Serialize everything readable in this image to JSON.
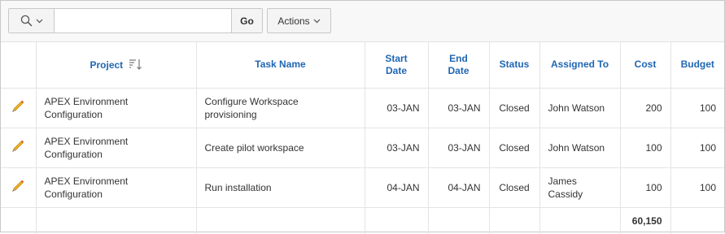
{
  "toolbar": {
    "search_placeholder": "",
    "search_value": "",
    "go_label": "Go",
    "actions_label": "Actions"
  },
  "columns": {
    "project": "Project",
    "task_name": "Task Name",
    "start_date_1": "Start",
    "start_date_2": "Date",
    "end_date_1": "End",
    "end_date_2": "Date",
    "status": "Status",
    "assigned_to": "Assigned To",
    "cost": "Cost",
    "budget": "Budget"
  },
  "rows": [
    {
      "project_1": "APEX Environment",
      "project_2": "Configuration",
      "task_1": "Configure Workspace",
      "task_2": "provisioning",
      "start_date": "03-JAN",
      "end_date": "03-JAN",
      "status": "Closed",
      "assigned_1": "John Watson",
      "assigned_2": "",
      "cost": "200",
      "budget": "100"
    },
    {
      "project_1": "APEX Environment",
      "project_2": "Configuration",
      "task_1": "Create pilot workspace",
      "task_2": "",
      "start_date": "03-JAN",
      "end_date": "03-JAN",
      "status": "Closed",
      "assigned_1": "John Watson",
      "assigned_2": "",
      "cost": "100",
      "budget": "100"
    },
    {
      "project_1": "APEX Environment",
      "project_2": "Configuration",
      "task_1": "Run installation",
      "task_2": "",
      "start_date": "04-JAN",
      "end_date": "04-JAN",
      "status": "Closed",
      "assigned_1": "James",
      "assigned_2": "Cassidy",
      "cost": "100",
      "budget": "100"
    }
  ],
  "totals": {
    "cost": "60,150"
  },
  "icons": {
    "search": "search-icon",
    "chevron": "chevron-down-icon",
    "sort": "sort-descending-icon",
    "edit": "pencil-icon"
  },
  "colors": {
    "header_link": "#1f66b3",
    "pencil_body": "#f2b21b",
    "pencil_tip": "#d9541e"
  }
}
